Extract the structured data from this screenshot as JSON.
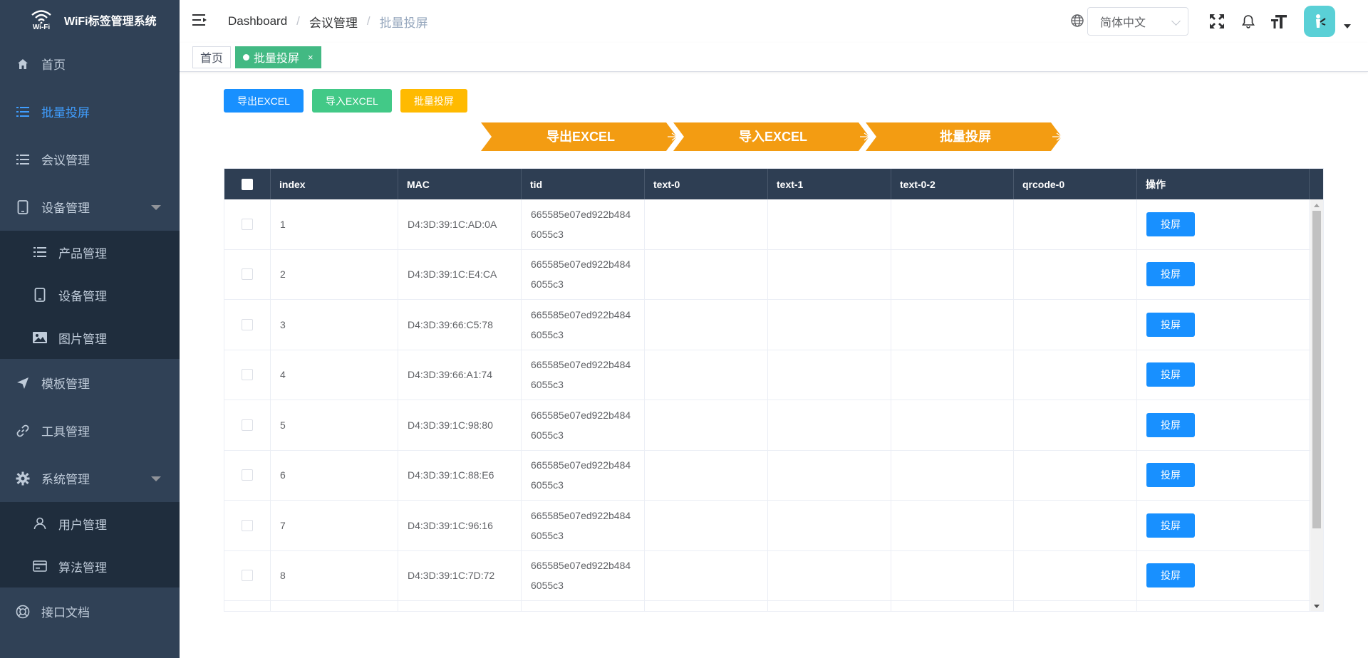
{
  "app": {
    "logo_text": "WiFi标签管理系统",
    "logo_mark_text": "Wi-Fi"
  },
  "sidebar": {
    "items": [
      {
        "label": "首页",
        "icon": "home-icon"
      },
      {
        "label": "批量投屏",
        "icon": "list-icon",
        "active": true
      },
      {
        "label": "会议管理",
        "icon": "list-icon"
      },
      {
        "label": "设备管理",
        "icon": "tablet-icon",
        "expanded": true,
        "children": [
          {
            "label": "产品管理",
            "icon": "list-icon"
          },
          {
            "label": "设备管理",
            "icon": "tablet-icon"
          },
          {
            "label": "图片管理",
            "icon": "image-icon"
          }
        ]
      },
      {
        "label": "模板管理",
        "icon": "send-icon"
      },
      {
        "label": "工具管理",
        "icon": "link-icon"
      },
      {
        "label": "系统管理",
        "icon": "gear-icon",
        "expanded": true,
        "children": [
          {
            "label": "用户管理",
            "icon": "user-icon"
          },
          {
            "label": "算法管理",
            "icon": "card-icon"
          }
        ]
      },
      {
        "label": "接口文档",
        "icon": "lifebuoy-icon"
      }
    ]
  },
  "header": {
    "breadcrumb": [
      "Dashboard",
      "会议管理",
      "批量投屏"
    ],
    "language": "简体中文"
  },
  "tags": [
    {
      "label": "首页",
      "active": false
    },
    {
      "label": "批量投屏",
      "active": true
    }
  ],
  "actions": {
    "export": "导出EXCEL",
    "import": "导入EXCEL",
    "batch_cast": "批量投屏"
  },
  "steps": [
    "导出EXCEL",
    "导入EXCEL",
    "批量投屏"
  ],
  "table": {
    "columns": [
      "index",
      "MAC",
      "tid",
      "text-0",
      "text-1",
      "text-0-2",
      "qrcode-0",
      "操作"
    ],
    "action_label": "投屏",
    "rows": [
      {
        "index": "1",
        "mac": "D4:3D:39:1C:AD:0A",
        "tid": "665585e07ed922b4846055c3"
      },
      {
        "index": "2",
        "mac": "D4:3D:39:1C:E4:CA",
        "tid": "665585e07ed922b4846055c3"
      },
      {
        "index": "3",
        "mac": "D4:3D:39:66:C5:78",
        "tid": "665585e07ed922b4846055c3"
      },
      {
        "index": "4",
        "mac": "D4:3D:39:66:A1:74",
        "tid": "665585e07ed922b4846055c3"
      },
      {
        "index": "5",
        "mac": "D4:3D:39:1C:98:80",
        "tid": "665585e07ed922b4846055c3"
      },
      {
        "index": "6",
        "mac": "D4:3D:39:1C:88:E6",
        "tid": "665585e07ed922b4846055c3"
      },
      {
        "index": "7",
        "mac": "D4:3D:39:1C:96:16",
        "tid": "665585e07ed922b4846055c3"
      },
      {
        "index": "8",
        "mac": "D4:3D:39:1C:7D:72",
        "tid": "665585e07ed922b4846055c3"
      }
    ]
  },
  "colors": {
    "sidebar_bg": "#304156",
    "submenu_bg": "#1f2d3d",
    "active": "#409eff",
    "primary": "#1890ff",
    "success": "#42c987",
    "warning": "#ffba00",
    "step": "#f39c12",
    "table_header": "#2e3e53"
  }
}
